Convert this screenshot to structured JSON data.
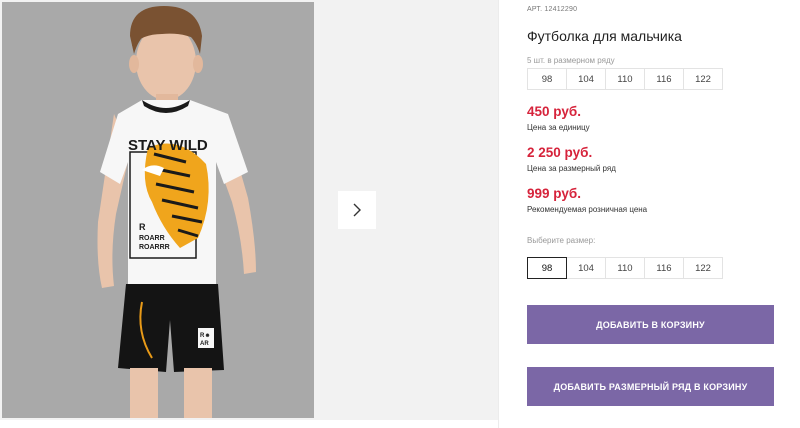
{
  "product": {
    "article": "АРТ. 12412290",
    "title": "Футболка для мальчика",
    "pack_hint": "5 шт. в размерном ряду",
    "pack_sizes": [
      "98",
      "104",
      "110",
      "116",
      "122"
    ],
    "price_unit": "450 руб.",
    "price_unit_label": "Цена за единицу",
    "price_row": "2 250 руб.",
    "price_row_label": "Цена за размерный ряд",
    "price_rrp": "999 руб.",
    "price_rrp_label": "Рекомендуемая розничная цена",
    "choose_size_label": "Выберите размер:",
    "choose_sizes": [
      "98",
      "104",
      "110",
      "116",
      "122"
    ],
    "selected_size": "98",
    "add_to_cart": "ДОБАВИТЬ В КОРЗИНУ",
    "add_row_to_cart": "ДОБАВИТЬ РАЗМЕРНЫЙ РЯД В КОРЗИНУ"
  },
  "photo": {
    "shirt_print_line1": "STAY WILD",
    "shirt_print_r": "R",
    "shirt_print_line2": "ROARR",
    "shirt_print_line3": "ROARRR",
    "shorts_patch_top": "R☻",
    "shorts_patch_bottom": "AR"
  },
  "icons": {
    "next": "chevron-right-icon"
  },
  "colors": {
    "price": "#d6233b",
    "button": "#7b67a6",
    "photo_bg": "#a9a9a9",
    "gallery_bg": "#f2f2f2"
  }
}
